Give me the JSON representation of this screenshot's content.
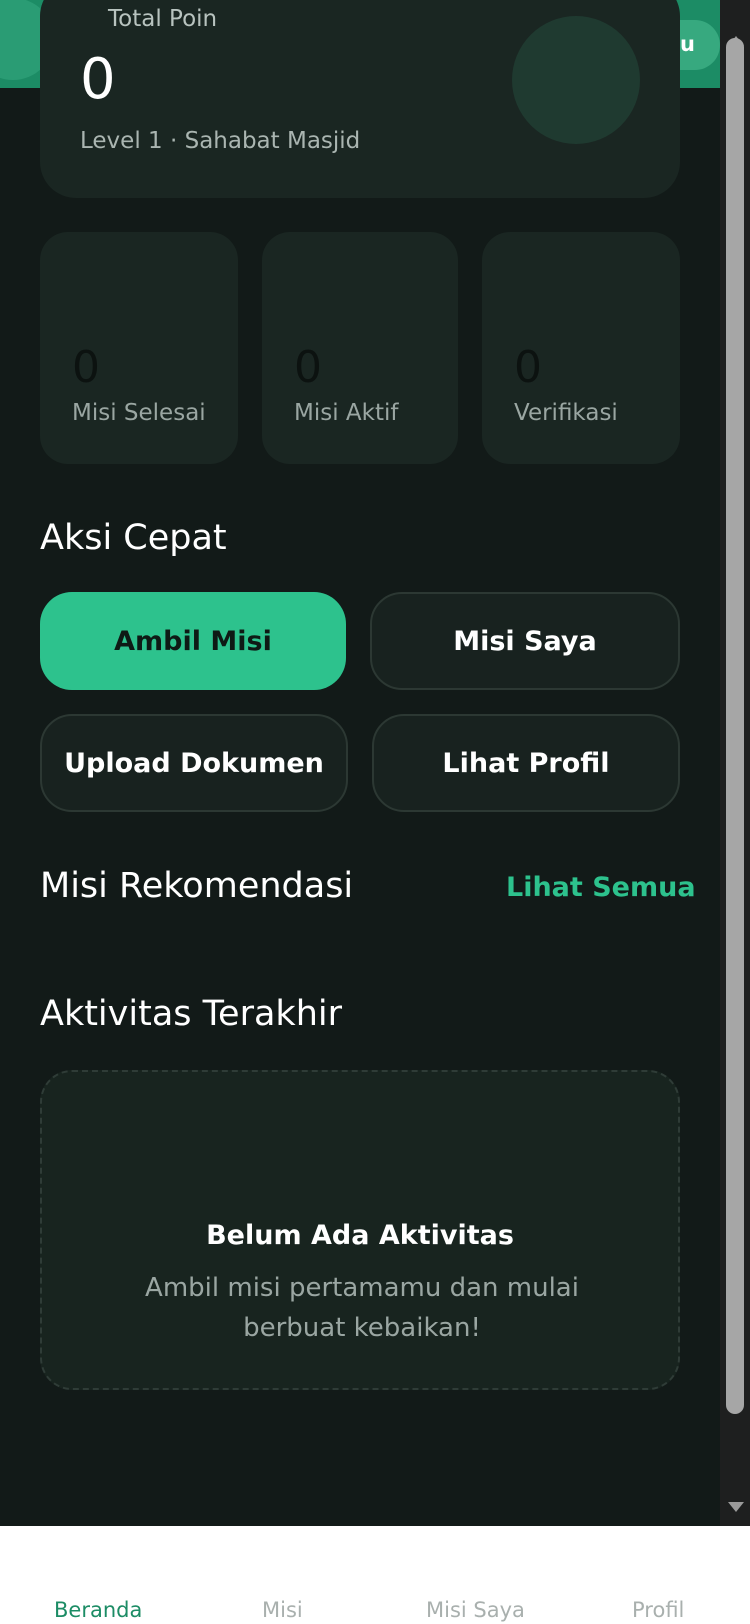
{
  "header": {
    "pill_label": "u"
  },
  "points": {
    "label": "Total Poin",
    "value": "0",
    "level": "Level 1 · Sahabat Masjid"
  },
  "stats": [
    {
      "value": "0",
      "label": "Misi Selesai"
    },
    {
      "value": "0",
      "label": "Misi Aktif"
    },
    {
      "value": "0",
      "label": "Verifikasi"
    }
  ],
  "quick_actions": {
    "title": "Aksi Cepat",
    "buttons": [
      {
        "label": "Ambil Misi"
      },
      {
        "label": "Misi Saya"
      },
      {
        "label": "Upload Dokumen"
      },
      {
        "label": "Lihat Profil"
      }
    ]
  },
  "recommended": {
    "title": "Misi Rekomendasi",
    "see_all": "Lihat Semua"
  },
  "activity": {
    "title": "Aktivitas Terakhir",
    "empty_title": "Belum Ada Aktivitas",
    "empty_desc": "Ambil misi pertamamu dan mulai berbuat kebaikan!"
  },
  "nav": {
    "items": [
      {
        "label": "Beranda"
      },
      {
        "label": "Misi"
      },
      {
        "label": "Misi Saya"
      },
      {
        "label": "Profil"
      }
    ]
  },
  "colors": {
    "accent": "#2dc28d",
    "header_green": "#1c8c65",
    "background": "#121a18",
    "card": "#1a2622"
  }
}
